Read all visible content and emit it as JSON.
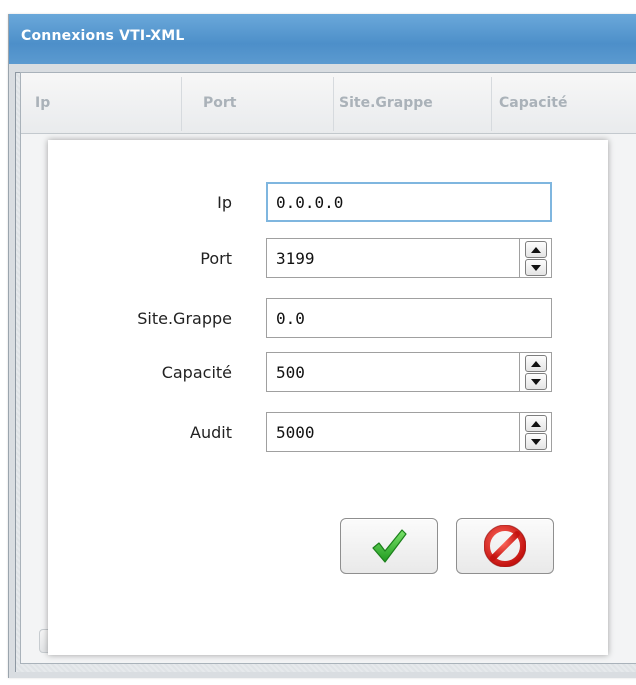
{
  "window": {
    "title": "Connexions VTI-XML"
  },
  "grid": {
    "columns": [
      "Ip",
      "Port",
      "Site.Grappe",
      "Capacité"
    ]
  },
  "dialog": {
    "fields": [
      {
        "label": "Ip",
        "value": "0.0.0.0",
        "type": "text",
        "focused": true
      },
      {
        "label": "Port",
        "value": "3199",
        "type": "spinner"
      },
      {
        "label": "Site.Grappe",
        "value": "0.0",
        "type": "text"
      },
      {
        "label": "Capacité",
        "value": "500",
        "type": "spinner"
      },
      {
        "label": "Audit",
        "value": "5000",
        "type": "spinner"
      }
    ],
    "buttons": {
      "confirm_icon": "green-checkmark-icon",
      "cancel_icon": "red-prohibited-icon"
    }
  },
  "colors": {
    "titlebar": "#5b9ad0",
    "focus_border": "#7fb6df",
    "confirm": "#2fb82f",
    "cancel": "#e0201e"
  }
}
